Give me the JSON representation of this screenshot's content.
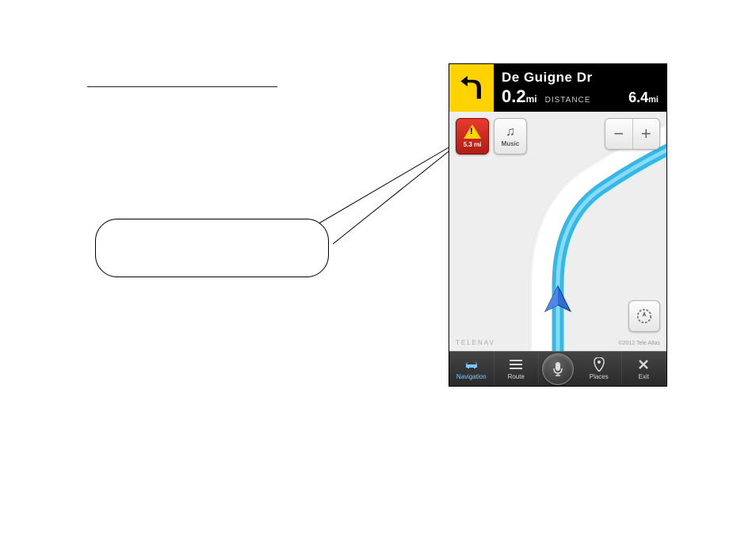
{
  "document": {
    "underline_present": true
  },
  "callout": {
    "text": ""
  },
  "nav": {
    "street": "De Guigne Dr",
    "next_distance_value": "0.2",
    "next_distance_unit": "mi",
    "distance_label": "DISTANCE",
    "total_distance_value": "6.4",
    "total_distance_unit": "mi",
    "turn": "left"
  },
  "map_buttons": {
    "traffic_distance": "5.3 mi",
    "music_label": "Music",
    "zoom_out": "−",
    "zoom_in": "+"
  },
  "attribution": {
    "left": "TELENAV",
    "right": "©2012 Tele Atlas"
  },
  "bottom_bar": {
    "navigation": "Navigation",
    "route": "Route",
    "places": "Places",
    "exit": "Exit"
  }
}
